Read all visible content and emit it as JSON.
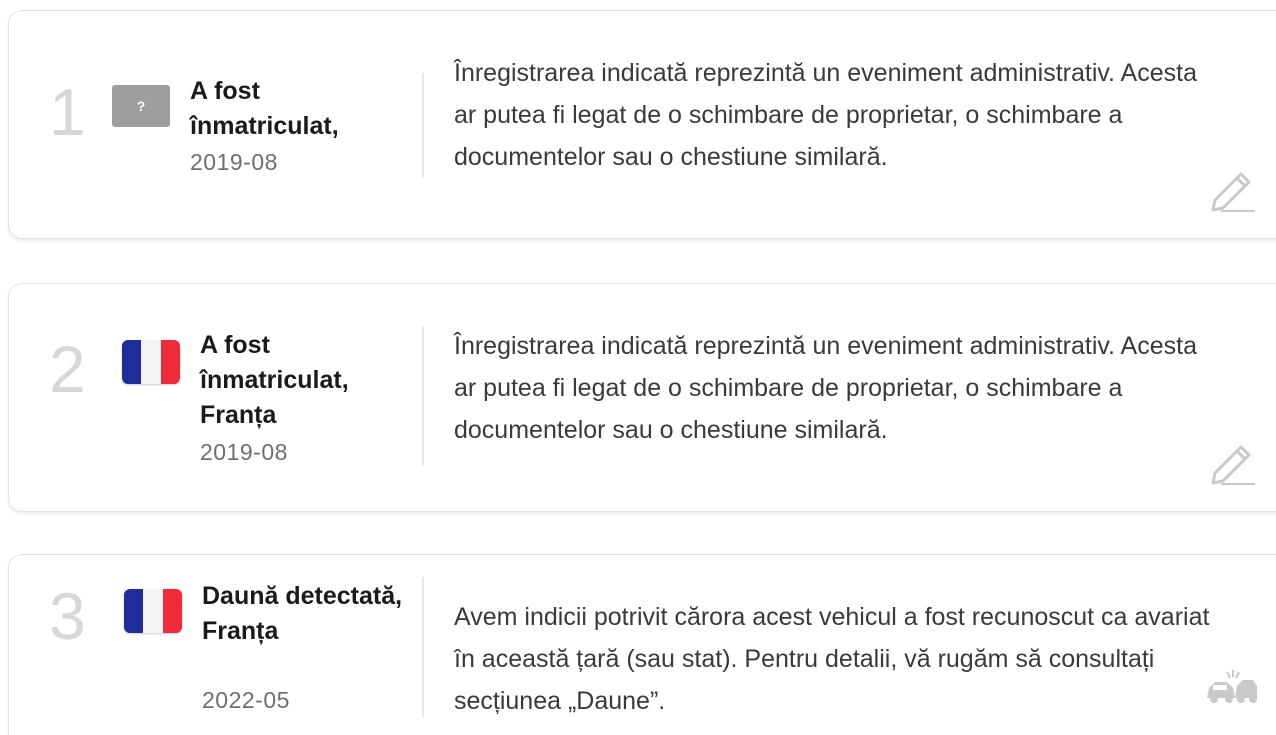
{
  "events": [
    {
      "number": "1",
      "flag": "unknown",
      "flag_glyph": "?",
      "title": "A fost înmatriculat,",
      "date": "2019-08",
      "description": "Înregistrarea indicată reprezintă un eveniment administrativ. Acesta ar putea fi legat de o schimbare de proprietar, o schimbare a documentelor sau o chestiune similară.",
      "icon": "pencil-icon"
    },
    {
      "number": "2",
      "flag": "france",
      "title": "A fost înmatriculat, Franța",
      "date": "2019-08",
      "description": "Înregistrarea indicată reprezintă un eveniment administrativ. Acesta ar putea fi legat de o schimbare de proprietar, o schimbare a documentelor sau o chestiune similară.",
      "icon": "pencil-icon"
    },
    {
      "number": "3",
      "flag": "france",
      "title": "Daună detectată, Franța",
      "date": "2022-05",
      "description": "Avem indicii potrivit cărora acest vehicul a fost recunoscut ca avariat în această țară (sau stat). Pentru detalii, vă rugăm să consultați secțiunea „Daune”.",
      "icon": "car-crash-icon"
    }
  ],
  "colors": {
    "number": "#d7d7d7",
    "unknown_flag": "#9e9e9e",
    "france_blue": "#1f2d9b",
    "france_red": "#ef2b3a",
    "icon": "#c9c9c9"
  }
}
